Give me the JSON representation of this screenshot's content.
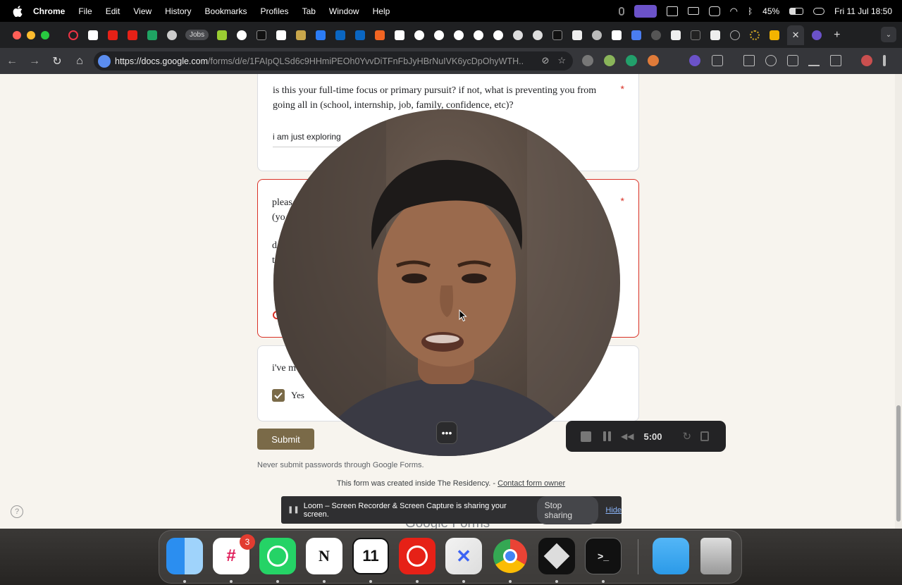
{
  "menubar": {
    "app": "Chrome",
    "items": [
      "File",
      "Edit",
      "View",
      "History",
      "Bookmarks",
      "Profiles",
      "Tab",
      "Window",
      "Help"
    ],
    "battery": "45%",
    "datetime": "Fri 11 Jul  18:50"
  },
  "tabs": {
    "pill_label": "Jobs",
    "active_close": "✕",
    "new_tab": "+"
  },
  "toolbar": {
    "url_host": "https://docs.google.com",
    "url_path": "/forms/d/e/1FAIpQLSd6c9HHmiPEOh0YvvDiTFnFbJyHBrNuIVK6ycDpOhyWTH..."
  },
  "form": {
    "q1": {
      "title": "is this your full-time focus or primary pursuit? if not, what is preventing you from going all in (school, internship, job, family, confidence, etc)?",
      "required_mark": "*",
      "answer": "i am just exploring"
    },
    "q2": {
      "line1": "pleas",
      "line2": "(yo",
      "line3": "d",
      "line4": "t",
      "required_mark": "*"
    },
    "q3": {
      "title": "i've m",
      "option": "Yes"
    },
    "submit_label": "Submit",
    "password_note": "Never submit passwords through Google Forms.",
    "created_text": "This form was created inside The Residency. - ",
    "contact_link": "Contact form owner",
    "brand": "Google Forms"
  },
  "loom": {
    "timer": "5:00",
    "more": "•••",
    "banner_text": "Loom – Screen Recorder & Screen Capture is sharing your screen.",
    "stop_sharing": "Stop sharing",
    "hide": "Hide"
  },
  "dock": {
    "slack_badge": "3",
    "calendar_day": "11",
    "notion_letter": "N",
    "terminal_prompt": ">_"
  }
}
